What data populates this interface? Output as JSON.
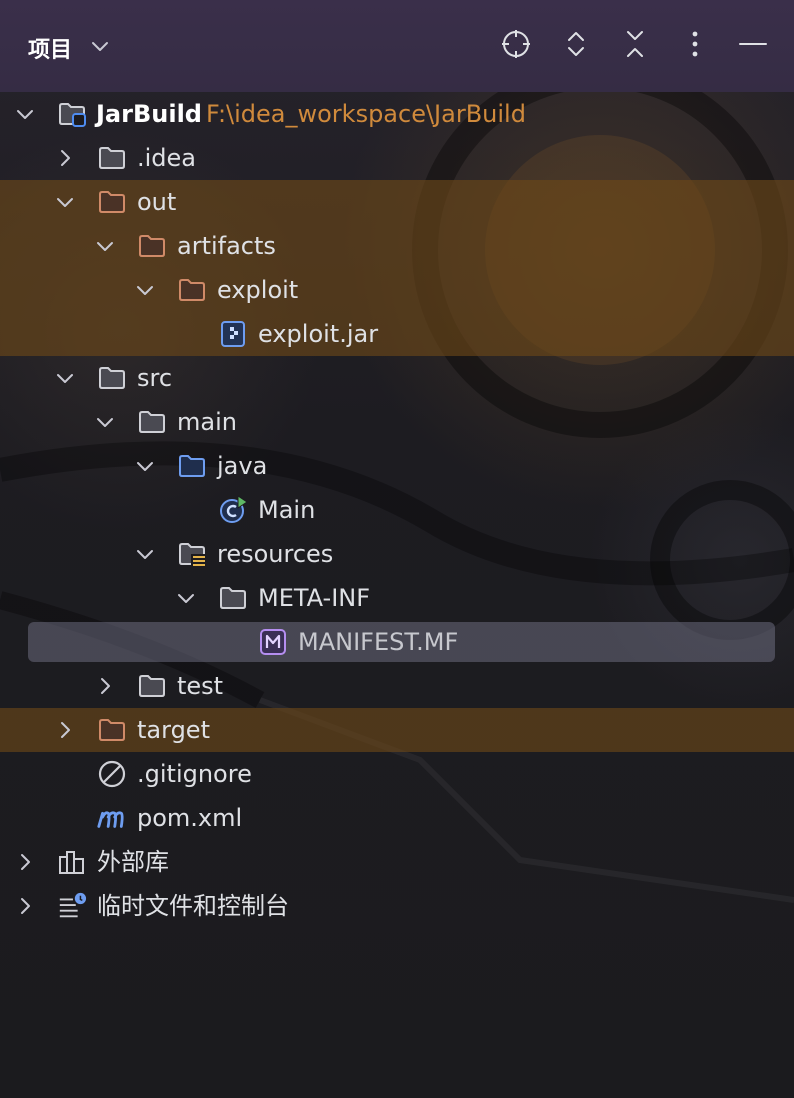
{
  "header": {
    "title": "项目",
    "icons": [
      "chevron-down-icon",
      "locate-icon",
      "expand-all-icon",
      "collapse-all-icon",
      "more-icon",
      "minimize-icon"
    ]
  },
  "tree": {
    "root": {
      "label": "JarBuild",
      "path": "F:\\idea_workspace\\JarBuild"
    },
    "idea": {
      "label": ".idea"
    },
    "out": {
      "label": "out"
    },
    "artifacts": {
      "label": "artifacts"
    },
    "exploit_dir": {
      "label": "exploit"
    },
    "exploit_jar": {
      "label": "exploit.jar"
    },
    "src": {
      "label": "src"
    },
    "main": {
      "label": "main"
    },
    "java": {
      "label": "java"
    },
    "main_class": {
      "label": "Main"
    },
    "resources": {
      "label": "resources"
    },
    "meta_inf": {
      "label": "META-INF"
    },
    "manifest": {
      "label": "MANIFEST.MF"
    },
    "test": {
      "label": "test"
    },
    "target": {
      "label": "target"
    },
    "gitignore": {
      "label": ".gitignore"
    },
    "pom": {
      "label": "pom.xml"
    },
    "external_libs": {
      "label": "外部库"
    },
    "scratches": {
      "label": "临时文件和控制台"
    }
  },
  "colors": {
    "header_bg": "#372d47",
    "excluded_highlight": "#6e4819",
    "selection": "#5a5a6e",
    "path_text": "#d08a3c",
    "folder_excluded": "#d08a68",
    "folder_source": "#6e9df0",
    "accent_purple": "#b58ef0",
    "run_green": "#5fb865"
  }
}
